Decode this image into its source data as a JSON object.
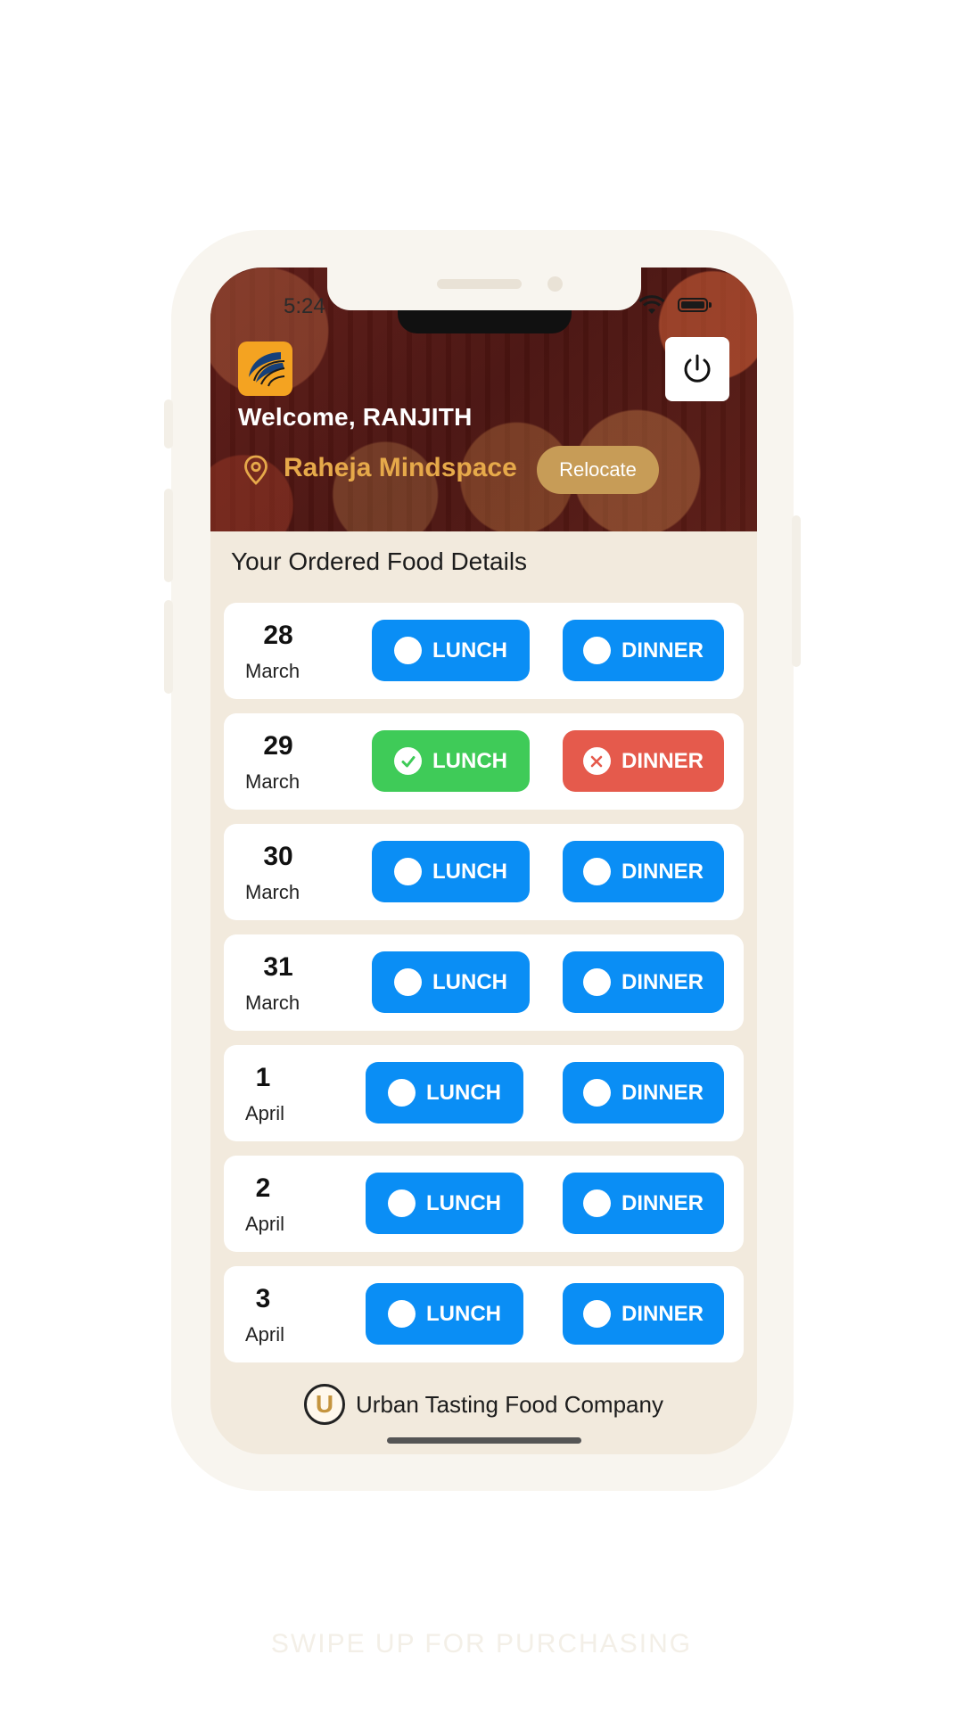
{
  "status_bar": {
    "time": "5:24"
  },
  "header": {
    "welcome_text": "Welcome, RANJITH",
    "location_name": "Raheja Mindspace",
    "relocate_label": "Relocate"
  },
  "section_title": "Your Ordered Food Details",
  "meal_labels": {
    "lunch": "LUNCH",
    "dinner": "DINNER"
  },
  "orders": [
    {
      "day": "28",
      "month": "March",
      "lunch_status": "none",
      "dinner_status": "none"
    },
    {
      "day": "29",
      "month": "March",
      "lunch_status": "confirmed",
      "dinner_status": "cancelled"
    },
    {
      "day": "30",
      "month": "March",
      "lunch_status": "none",
      "dinner_status": "none"
    },
    {
      "day": "31",
      "month": "March",
      "lunch_status": "none",
      "dinner_status": "none"
    },
    {
      "day": "1",
      "month": "April",
      "lunch_status": "none",
      "dinner_status": "none"
    },
    {
      "day": "2",
      "month": "April",
      "lunch_status": "none",
      "dinner_status": "none"
    },
    {
      "day": "3",
      "month": "April",
      "lunch_status": "none",
      "dinner_status": "none"
    }
  ],
  "footer": {
    "company_name": "Urban Tasting Food Company",
    "logo_letter": "U"
  },
  "swipe_hint": "SWIPE UP FOR PURCHASING",
  "colors": {
    "primary_blue": "#0a8ef5",
    "confirmed_green": "#3fcb58",
    "cancelled_red": "#e55a4c",
    "accent_gold": "#c79c57",
    "header_maroon": "#4a1411",
    "screen_bg": "#f2eadd"
  },
  "icons": {
    "power": "power-icon",
    "location": "location-pin-icon",
    "confirmed": "check-circle-icon",
    "cancelled": "x-circle-icon",
    "unselected": "empty-circle-icon"
  }
}
